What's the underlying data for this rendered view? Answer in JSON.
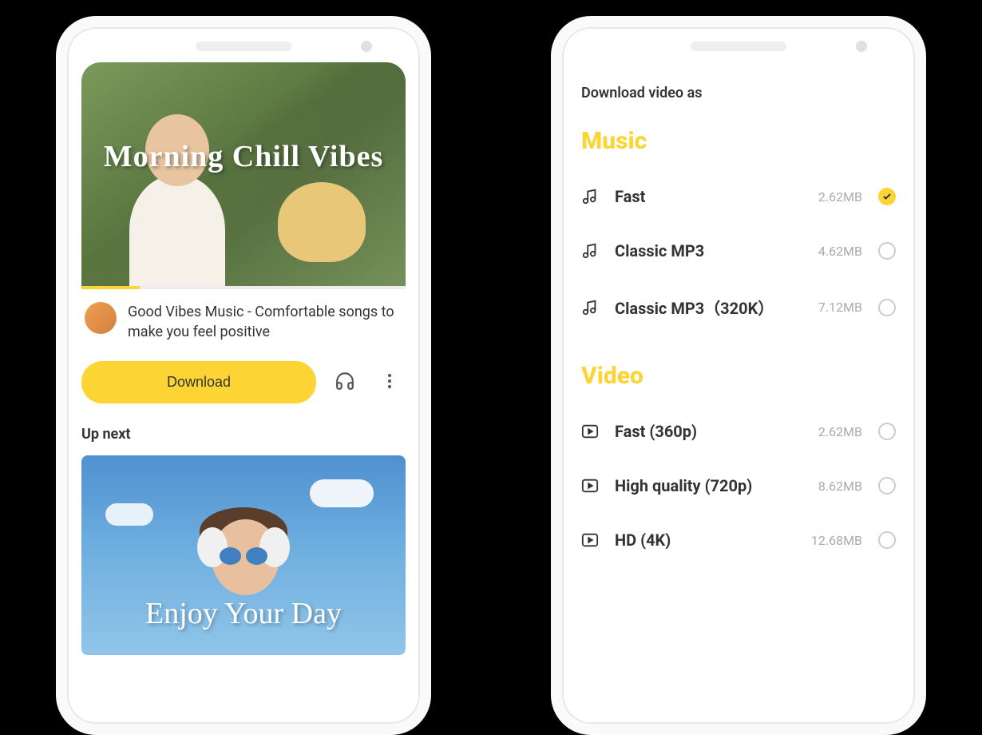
{
  "phone1": {
    "hero_title": "Morning Chill Vibes",
    "video_title": "Good Vibes Music - Comfortable songs to make you feel positive",
    "download_label": "Download",
    "up_next_label": "Up next",
    "up_next_title": "Enjoy Your Day"
  },
  "phone2": {
    "header": "Download video as",
    "music_heading": "Music",
    "video_heading": "Video",
    "music_options": [
      {
        "label": "Fast",
        "size": "2.62MB",
        "checked": true
      },
      {
        "label": "Classic MP3",
        "size": "4.62MB",
        "checked": false
      },
      {
        "label": "Classic MP3（320K）",
        "size": "7.12MB",
        "checked": false
      }
    ],
    "video_options": [
      {
        "label": "Fast (360p)",
        "size": "2.62MB",
        "checked": false
      },
      {
        "label": "High quality (720p)",
        "size": "8.62MB",
        "checked": false
      },
      {
        "label": "HD (4K)",
        "size": "12.68MB",
        "checked": false
      }
    ]
  },
  "colors": {
    "accent": "#fcd535",
    "text": "#333333",
    "muted": "#aaaaaa"
  }
}
